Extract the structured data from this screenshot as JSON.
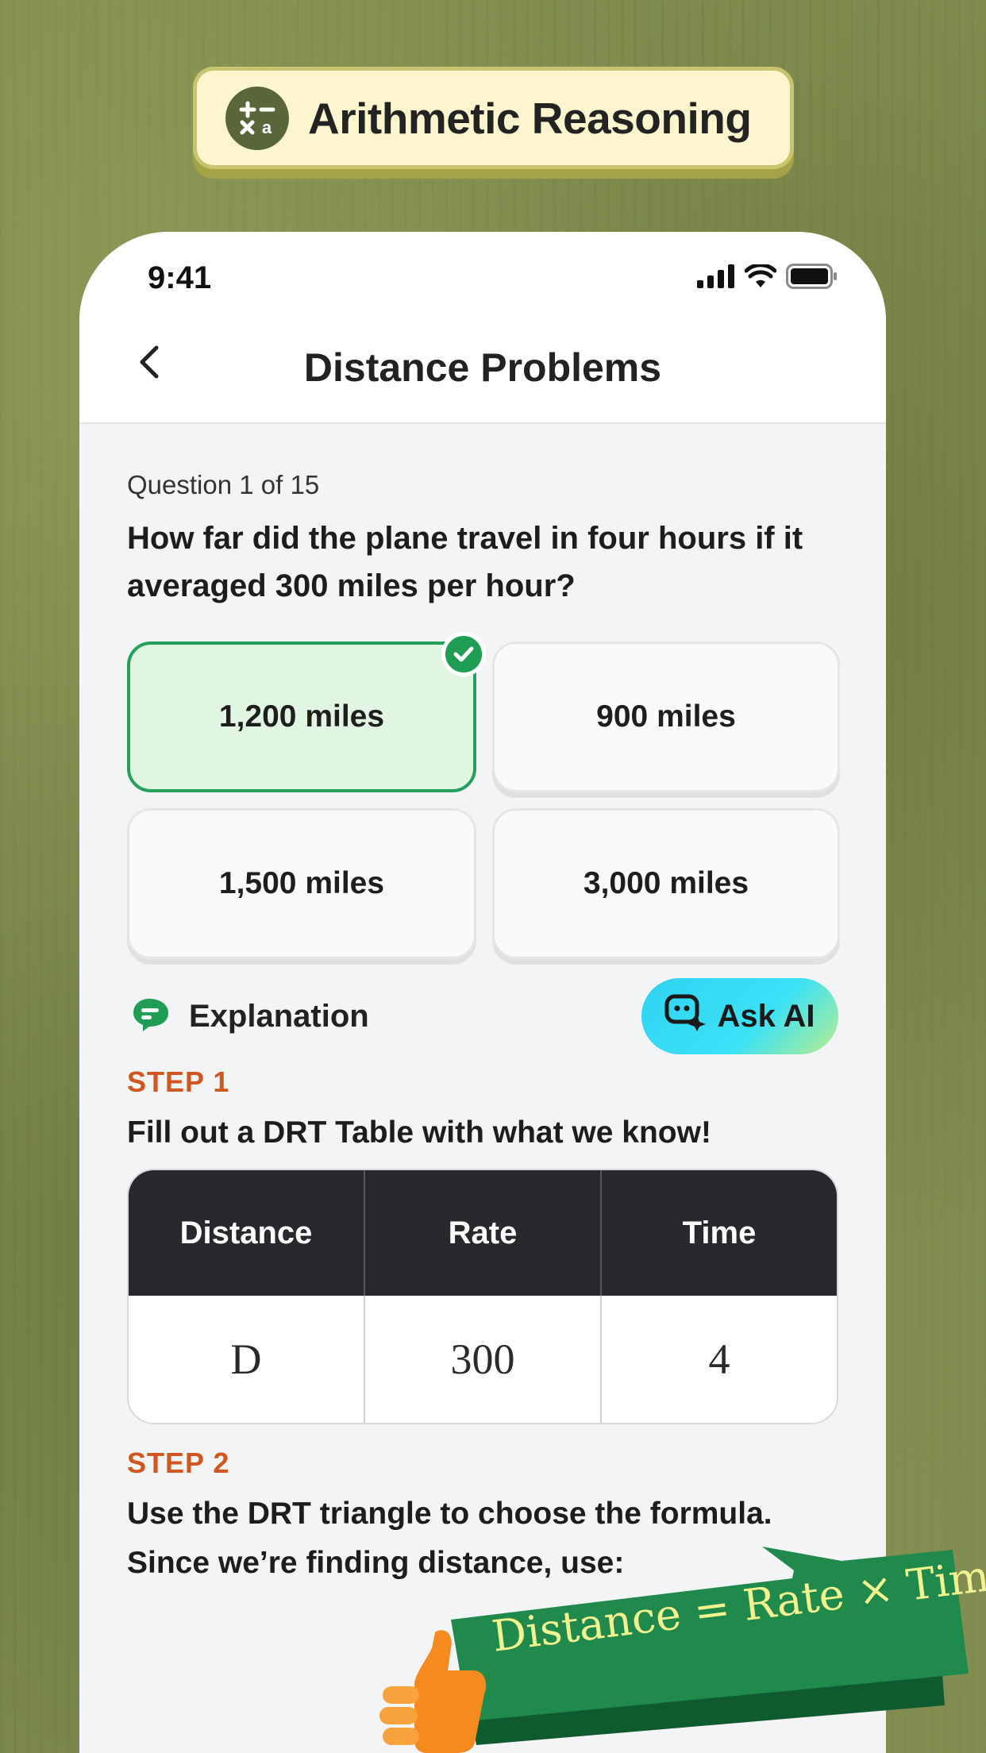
{
  "category": {
    "title": "Arithmetic Reasoning",
    "icon": "math-operators-icon"
  },
  "status_bar": {
    "time": "9:41",
    "icons": [
      "signal-icon",
      "wifi-icon",
      "battery-icon"
    ]
  },
  "nav": {
    "title": "Distance Problems",
    "back_icon": "chevron-left-icon"
  },
  "question": {
    "counter": "Question 1 of 15",
    "text": "How far did the plane travel in four hours if it averaged 300 miles per hour?"
  },
  "answers": [
    {
      "label": "1,200 miles",
      "correct": true
    },
    {
      "label": "900 miles",
      "correct": false
    },
    {
      "label": "1,500 miles",
      "correct": false
    },
    {
      "label": "3,000 miles",
      "correct": false
    }
  ],
  "explanation": {
    "label": "Explanation",
    "ask_ai_label": "Ask AI"
  },
  "steps": [
    {
      "label": "STEP 1",
      "text": "Fill out a DRT Table with what we know!"
    },
    {
      "label": "STEP 2",
      "text": "Use the DRT triangle to choose the formula. Since we’re finding distance, use:"
    }
  ],
  "drt_table": {
    "headers": [
      "Distance",
      "Rate",
      "Time"
    ],
    "values": [
      "D",
      "300",
      "4"
    ]
  },
  "formula": "Distance = Rate × Time",
  "colors": {
    "background": "#7f8c4d",
    "badge_bg": "#fdf5cd",
    "correct_green": "#1f9d55",
    "step_orange": "#d0571e",
    "table_header": "#27292c",
    "banner_green": "#1f8a4c",
    "formula_yellow": "#f2f28e"
  }
}
